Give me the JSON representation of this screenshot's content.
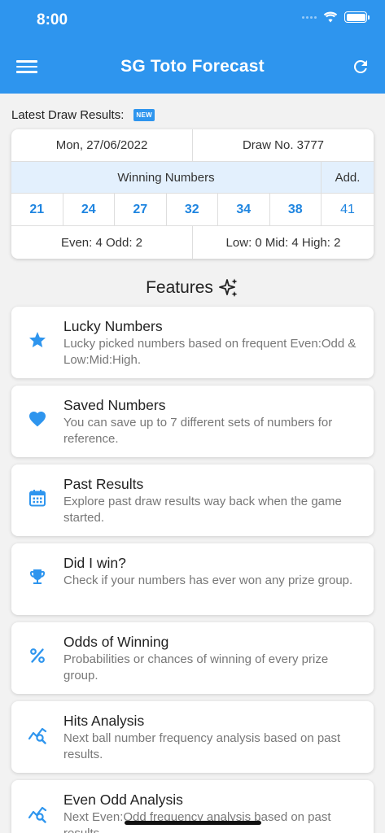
{
  "status_bar": {
    "time": "8:00"
  },
  "app": {
    "title": "SG Toto Forecast"
  },
  "latest": {
    "label": "Latest Draw Results:",
    "badge": "NEW"
  },
  "draw": {
    "date": "Mon, 27/06/2022",
    "number": "Draw No. 3777",
    "winning_header": "Winning Numbers",
    "additional_header": "Add.",
    "numbers": [
      "21",
      "24",
      "27",
      "32",
      "34",
      "38"
    ],
    "additional": "41",
    "even_odd": "Even: 4 Odd: 2",
    "low_mid_high": "Low: 0 Mid: 4 High: 2"
  },
  "features": {
    "title": "Features",
    "items": [
      {
        "title": "Lucky Numbers",
        "desc": "Lucky picked numbers based on frequent Even:Odd & Low:Mid:High.",
        "icon": "star-icon"
      },
      {
        "title": "Saved Numbers",
        "desc": "You can save up to 7 different sets of numbers for reference.",
        "icon": "heart-icon"
      },
      {
        "title": "Past Results",
        "desc": "Explore past draw results way back when the game started.",
        "icon": "calendar-icon"
      },
      {
        "title": "Did I win?",
        "desc": "Check if your numbers has ever won any prize group.",
        "icon": "trophy-icon"
      },
      {
        "title": "Odds of Winning",
        "desc": "Probabilities or chances of winning of every prize group.",
        "icon": "percent-icon"
      },
      {
        "title": "Hits Analysis",
        "desc": "Next ball number frequency analysis based on past results.",
        "icon": "analytics-icon"
      },
      {
        "title": "Even Odd Analysis",
        "desc": "Next Even:Odd frequency analysis based on past results.",
        "icon": "analytics-icon"
      }
    ]
  },
  "colors": {
    "primary": "#2e95ee",
    "number": "#1f85e0",
    "header_bg": "#e3f0fd"
  }
}
